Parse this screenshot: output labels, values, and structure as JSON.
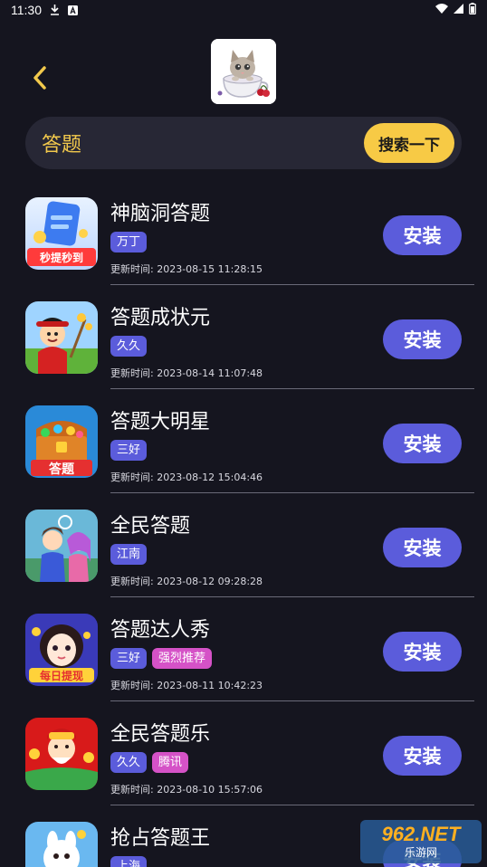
{
  "status_bar": {
    "time": "11:30"
  },
  "search": {
    "value": "答题",
    "button_label": "搜索一下"
  },
  "apps": [
    {
      "name": "神脑洞答题",
      "tags": [
        "万丁"
      ],
      "update_time": "更新时间: 2023-08-15 11:28:15",
      "install_label": "安装"
    },
    {
      "name": "答题成状元",
      "tags": [
        "久久"
      ],
      "update_time": "更新时间: 2023-08-14 11:07:48",
      "install_label": "安装"
    },
    {
      "name": "答题大明星",
      "tags": [
        "三好"
      ],
      "update_time": "更新时间: 2023-08-12 15:04:46",
      "install_label": "安装"
    },
    {
      "name": "全民答题",
      "tags": [
        "江南"
      ],
      "update_time": "更新时间: 2023-08-12 09:28:28",
      "install_label": "安装"
    },
    {
      "name": "答题达人秀",
      "tags": [
        "三好",
        "强烈推荐"
      ],
      "update_time": "更新时间: 2023-08-11 10:42:23",
      "install_label": "安装"
    },
    {
      "name": "全民答题乐",
      "tags": [
        "久久",
        "腾讯"
      ],
      "update_time": "更新时间: 2023-08-10 15:57:06",
      "install_label": "安装"
    },
    {
      "name": "抢占答题王",
      "tags": [
        "上海"
      ],
      "update_time": "",
      "install_label": "安装"
    }
  ],
  "icon_labels": {
    "app1": "秒提秒到",
    "app3": "答题",
    "app5": "每日提现"
  },
  "watermark": {
    "brand": "962.NET",
    "sub": "乐游网"
  },
  "colors": {
    "background": "#15151f",
    "accent_yellow": "#f7ca45",
    "button_purple": "#5b5cdb",
    "tag_pink": "#d552c7"
  }
}
